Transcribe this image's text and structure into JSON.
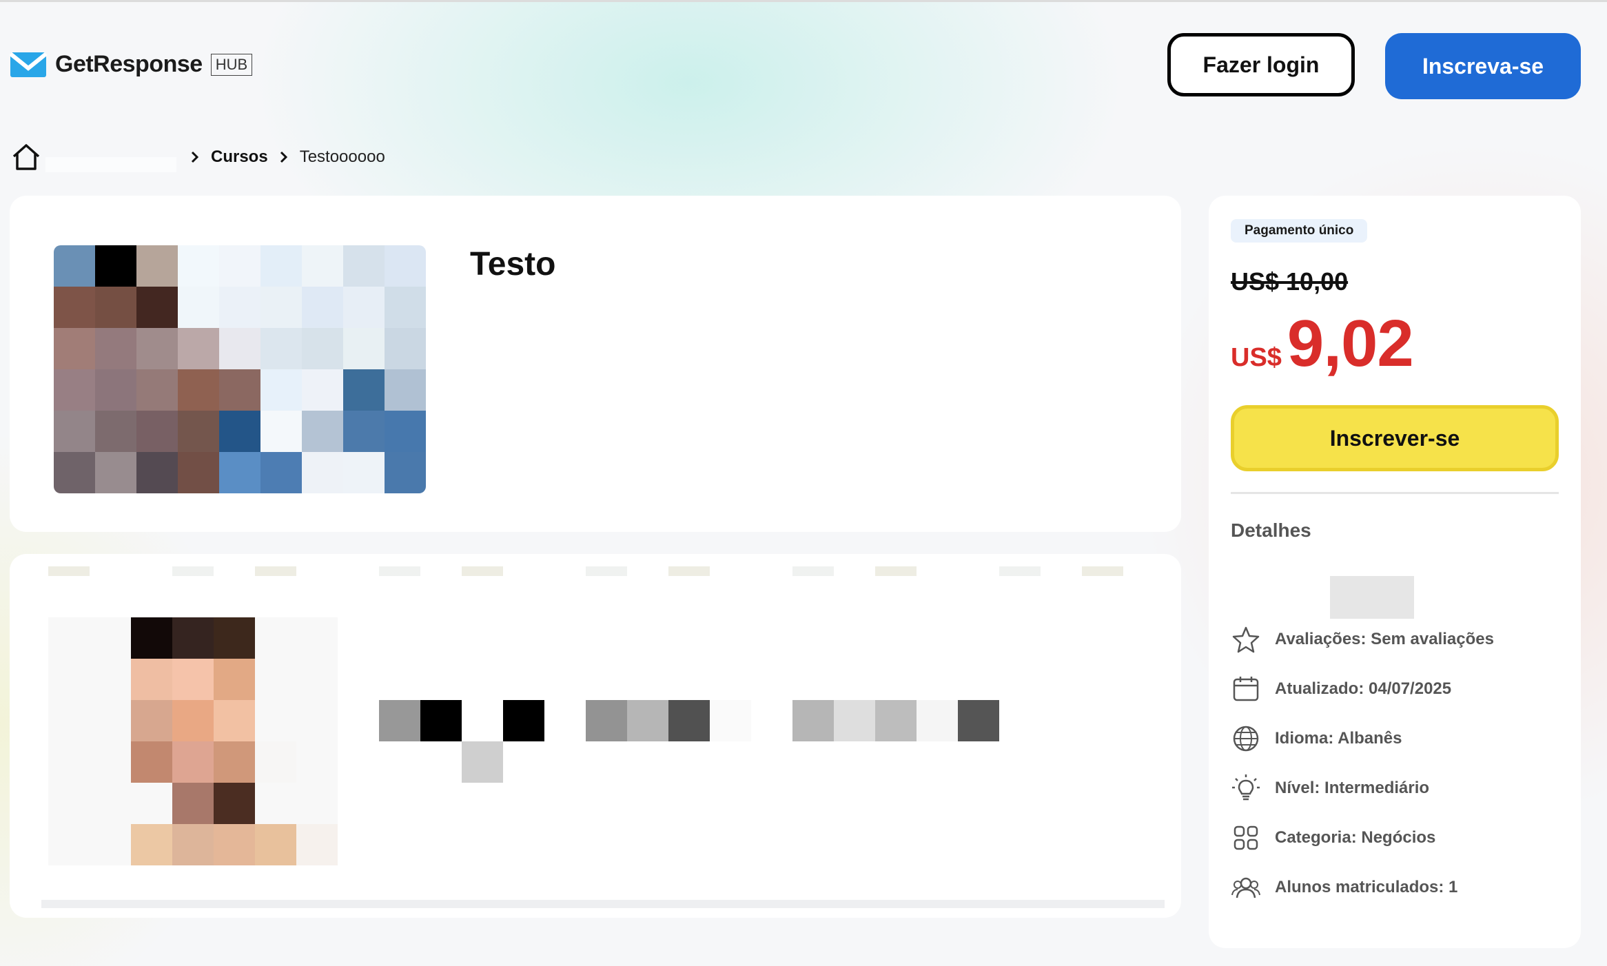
{
  "header": {
    "logo_text": "GetResponse",
    "logo_badge": "HUB",
    "login_label": "Fazer login",
    "signup_label": "Inscreva-se",
    "accent_color": "#1f6bd6"
  },
  "breadcrumb": {
    "home_icon": "home-icon",
    "items": [
      "Cursos",
      "Testoooooo"
    ]
  },
  "course": {
    "title": "Testo"
  },
  "pricing": {
    "badge": "Pagamento único",
    "old_price": "US$ 10,00",
    "currency": "US$",
    "price": "9,02",
    "enroll_label": "Inscrever-se",
    "price_color": "#d92d2a",
    "enroll_color": "#f6e24a"
  },
  "details": {
    "title": "Detalhes",
    "items": [
      {
        "icon": "star-icon",
        "text": "Avaliações: Sem avaliações"
      },
      {
        "icon": "calendar-icon",
        "text": "Atualizado: 04/07/2025"
      },
      {
        "icon": "globe-icon",
        "text": "Idioma: Albanês"
      },
      {
        "icon": "lightbulb-icon",
        "text": "Nível: Intermediário"
      },
      {
        "icon": "category-grid-icon",
        "text": "Categoria: Negócios"
      },
      {
        "icon": "users-icon",
        "text": "Alunos matriculados: 1"
      }
    ]
  },
  "course_image_pixels": [
    "#6a90b5",
    "#000000",
    "#b6a59a",
    "#f2f8fc",
    "#f1f5fa",
    "#e3eef8",
    "#eef4f8",
    "#d6e1eb",
    "#dbe6f3",
    "#7e5448",
    "#754f43",
    "#432721",
    "#f0f6fa",
    "#ebf1f8",
    "#eaf1f6",
    "#dfe9f5",
    "#e7eef6",
    "#d0dde8",
    "#a17d77",
    "#947a7d",
    "#a08c8c",
    "#bba8a8",
    "#e8e8ee",
    "#dce6ee",
    "#d7e2ea",
    "#e8f0f3",
    "#cad7e3",
    "#987f84",
    "#8c757b",
    "#957a78",
    "#8f6151",
    "#8b6861",
    "#e7f1fa",
    "#eef2f8",
    "#3d6e9a",
    "#b0c1d3",
    "#938589",
    "#7d6b6e",
    "#786064",
    "#74564d",
    "#235588",
    "#f4f8fb",
    "#b4c3d4",
    "#4c7aab",
    "#4778ad",
    "#6f6369",
    "#988c8f",
    "#544a52",
    "#724f46",
    "#5a8ec5",
    "#4d7db3",
    "#eef2f7",
    "#eef3f8",
    "#4a79ac"
  ],
  "author_image_pixels": [
    "#f8f8f8",
    "#f8f8f8",
    "#120908",
    "#352420",
    "#3d281c",
    "#f8f8f8",
    "#f8f8f8",
    "#f8f8f8",
    "#f8f8f8",
    "#efbea3",
    "#f5c3aa",
    "#e2a985",
    "#f8f8f8",
    "#f8f8f8",
    "#f8f8f8",
    "#f8f8f8",
    "#d7a78f",
    "#e9a884",
    "#f2c1a3",
    "#f8f8f8",
    "#f8f8f8",
    "#f8f8f8",
    "#f8f8f8",
    "#c2886f",
    "#dea592",
    "#d0987a",
    "#f7f6f5",
    "#f8f8f8",
    "#f8f8f8",
    "#f8f8f8",
    "#f8f8f8",
    "#a8786a",
    "#4b2d22",
    "#f8f8f8",
    "#f8f8f8",
    "#f8f8f8",
    "#f8f8f8",
    "#ecc8a4",
    "#ddb59a",
    "#e4b798",
    "#e8c19c",
    "#f6f1ed"
  ],
  "name_blur_pixels": [
    "#989898",
    "#000000",
    "#ffffff",
    "#000000",
    "#ffffff",
    "#939393",
    "#b6b6b6",
    "#515151",
    "#fafafa",
    "#ffffff",
    "#b6b6b6",
    "#dedede",
    "#bdbdbd",
    "#f5f5f5",
    "#555555",
    "#ffffff",
    "#ffffff",
    "#ffffff",
    "#cfcfcf",
    "#ffffff",
    "#ffffff",
    "#ffffff",
    "#ffffff",
    "#ffffff",
    "#ffffff",
    "#ffffff",
    "#ffffff",
    "#ffffff",
    "#ffffff",
    "#ffffff",
    "#ffffff",
    "#ffffff"
  ]
}
